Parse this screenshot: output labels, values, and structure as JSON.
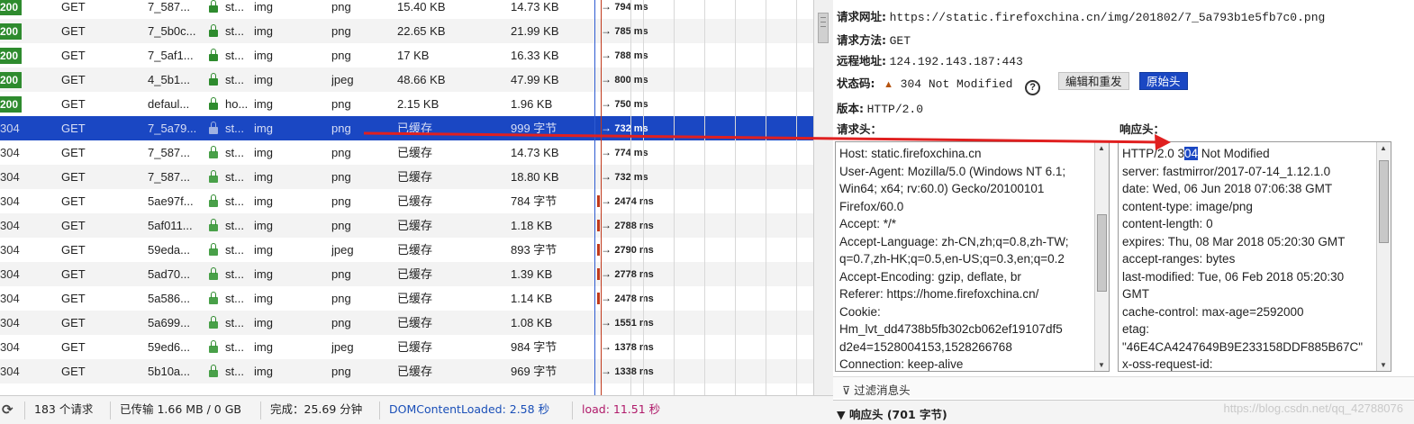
{
  "requests": [
    {
      "status": "200",
      "method": "GET",
      "file": "7_587...",
      "domain": "st...",
      "cause": "img",
      "type": "png",
      "transferred": "15.40 KB",
      "size": "14.73 KB",
      "time": "794 ms",
      "state": "ok"
    },
    {
      "status": "200",
      "method": "GET",
      "file": "7_5b0c...",
      "domain": "st...",
      "cause": "img",
      "type": "png",
      "transferred": "22.65 KB",
      "size": "21.99 KB",
      "time": "785 ms",
      "state": "ok"
    },
    {
      "status": "200",
      "method": "GET",
      "file": "7_5af1...",
      "domain": "st...",
      "cause": "img",
      "type": "png",
      "transferred": "17 KB",
      "size": "16.33 KB",
      "time": "788 ms",
      "state": "ok"
    },
    {
      "status": "200",
      "method": "GET",
      "file": "4_5b1...",
      "domain": "st...",
      "cause": "img",
      "type": "jpeg",
      "transferred": "48.66 KB",
      "size": "47.99 KB",
      "time": "800 ms",
      "state": "ok"
    },
    {
      "status": "200",
      "method": "GET",
      "file": "defaul...",
      "domain": "ho...",
      "cause": "img",
      "type": "png",
      "transferred": "2.15 KB",
      "size": "1.96 KB",
      "time": "750 ms",
      "state": "ok"
    },
    {
      "status": "304",
      "method": "GET",
      "file": "7_5a79...",
      "domain": "st...",
      "cause": "img",
      "type": "png",
      "transferred": "已缓存",
      "size": "999 字节",
      "time": "732 ms",
      "state": "selected"
    },
    {
      "status": "304",
      "method": "GET",
      "file": "7_587...",
      "domain": "st...",
      "cause": "img",
      "type": "png",
      "transferred": "已缓存",
      "size": "14.73 KB",
      "time": "774 ms",
      "state": "cached"
    },
    {
      "status": "304",
      "method": "GET",
      "file": "7_587...",
      "domain": "st...",
      "cause": "img",
      "type": "png",
      "transferred": "已缓存",
      "size": "18.80 KB",
      "time": "732 ms",
      "state": "cached"
    },
    {
      "status": "304",
      "method": "GET",
      "file": "5ae97f...",
      "domain": "st...",
      "cause": "img",
      "type": "png",
      "transferred": "已缓存",
      "size": "784 字节",
      "time": "2474 ms",
      "state": "cached"
    },
    {
      "status": "304",
      "method": "GET",
      "file": "5af011...",
      "domain": "st...",
      "cause": "img",
      "type": "png",
      "transferred": "已缓存",
      "size": "1.18 KB",
      "time": "2788 ms",
      "state": "cached"
    },
    {
      "status": "304",
      "method": "GET",
      "file": "59eda...",
      "domain": "st...",
      "cause": "img",
      "type": "jpeg",
      "transferred": "已缓存",
      "size": "893 字节",
      "time": "2790 ms",
      "state": "cached"
    },
    {
      "status": "304",
      "method": "GET",
      "file": "5ad70...",
      "domain": "st...",
      "cause": "img",
      "type": "png",
      "transferred": "已缓存",
      "size": "1.39 KB",
      "time": "2778 ms",
      "state": "cached"
    },
    {
      "status": "304",
      "method": "GET",
      "file": "5a586...",
      "domain": "st...",
      "cause": "img",
      "type": "png",
      "transferred": "已缓存",
      "size": "1.14 KB",
      "time": "2478 ms",
      "state": "cached"
    },
    {
      "status": "304",
      "method": "GET",
      "file": "5a699...",
      "domain": "st...",
      "cause": "img",
      "type": "png",
      "transferred": "已缓存",
      "size": "1.08 KB",
      "time": "1551 ms",
      "state": "cached"
    },
    {
      "status": "304",
      "method": "GET",
      "file": "59ed6...",
      "domain": "st...",
      "cause": "img",
      "type": "jpeg",
      "transferred": "已缓存",
      "size": "984 字节",
      "time": "1378 ms",
      "state": "cached"
    },
    {
      "status": "304",
      "method": "GET",
      "file": "5b10a...",
      "domain": "st...",
      "cause": "img",
      "type": "png",
      "transferred": "已缓存",
      "size": "969 字节",
      "time": "1338 ms",
      "state": "cached"
    }
  ],
  "statusbar": {
    "requests": "183 个请求",
    "transferred": "已传输 1.66 MB / 0 GB",
    "finish": "完成：25.69 分钟",
    "dom_loaded": "DOMContentLoaded: 2.58 秒",
    "load": "load: 11.51 秒",
    "colors": {
      "dom_loaded": "#1a4fb8",
      "load": "#b01a6a"
    }
  },
  "details": {
    "url_label": "请求网址:",
    "url": "https://static.firefoxchina.cn/img/201802/7_5a793b1e5fb7c0.png",
    "method_label": "请求方法:",
    "method": "GET",
    "remote_label": "远程地址:",
    "remote": "124.192.143.187:443",
    "status_label": "状态码:",
    "status": "304 Not Modified",
    "help": "?",
    "edit_resend": "编辑和重发",
    "raw_headers": "原始头",
    "version_label": "版本:",
    "version": "HTTP/2.0",
    "request_headers_label": "请求头：",
    "response_headers_label": "响应头：",
    "request_headers": [
      "Host: static.firefoxchina.cn",
      "User-Agent: Mozilla/5.0 (Windows NT 6.1;",
      "Win64; x64; rv:60.0) Gecko/20100101",
      "Firefox/60.0",
      "Accept: */*",
      "Accept-Language: zh-CN,zh;q=0.8,zh-TW;",
      "q=0.7,zh-HK;q=0.5,en-US;q=0.3,en;q=0.2",
      "Accept-Encoding: gzip, deflate, br",
      "Referer: https://home.firefoxchina.cn/",
      "Cookie:",
      "Hm_lvt_dd4738b5fb302cb062ef19107df5",
      "d2e4=1528004153,1528266768",
      "Connection: keep-alive"
    ],
    "response_status_line": {
      "before": "HTTP/2.0 3",
      "highlight": "04",
      "after": " Not Modified"
    },
    "response_headers": [
      "server: fastmirror/2017-07-14_1.12.1.0",
      "date: Wed, 06 Jun 2018 07:06:38 GMT",
      "content-type: image/png",
      "content-length: 0",
      "expires: Thu, 08 Mar 2018 05:20:30 GMT",
      "accept-ranges: bytes",
      "last-modified: Tue, 06 Feb 2018 05:20:30",
      "GMT",
      "cache-control: max-age=2592000",
      "etag:",
      "\"46E4CA4247649B9E233158DDF885B67C\"",
      "x-oss-request-id:"
    ],
    "filter_placeholder": "过滤消息头",
    "response_section": "响应头 (701 字节)"
  },
  "watermark": "https://blog.csdn.net/qq_42788076",
  "icons": {
    "lock": "lock-icon",
    "perf": "performance-icon",
    "filter": "filter-icon",
    "warning": "warning-triangle-icon",
    "help": "help-icon",
    "collapse": "triangle-down-icon"
  },
  "colors": {
    "selected_row": "#1a47c3",
    "status_ok": "#2e8b2e",
    "annotation_arrow": "#e02020"
  }
}
